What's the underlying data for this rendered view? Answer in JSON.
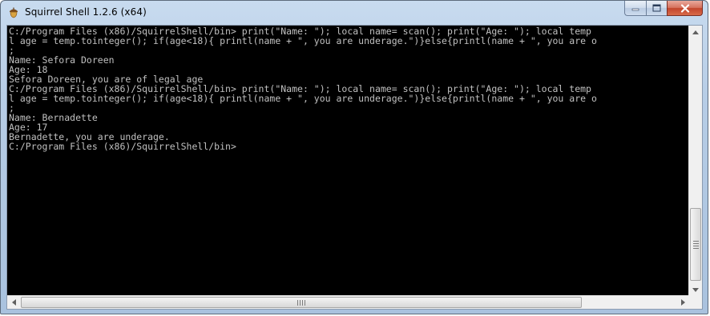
{
  "window": {
    "title": "Squirrel Shell 1.2.6 (x64)",
    "icon": "acorn-icon"
  },
  "caption_buttons": {
    "minimize_icon": "minimize-icon",
    "maximize_icon": "maximize-icon",
    "close_icon": "close-icon"
  },
  "console": {
    "lines": [
      "C:/Program Files (x86)/SquirrelShell/bin> print(\"Name: \"); local name= scan(); print(\"Age: \"); local temp",
      "l age = temp.tointeger(); if(age<18){ printl(name + \", you are underage.\")}else{printl(name + \", you are o",
      ";",
      "Name: Sefora Doreen",
      "Age: 18",
      "Sefora Doreen, you are of legal age",
      "C:/Program Files (x86)/SquirrelShell/bin> print(\"Name: \"); local name= scan(); print(\"Age: \"); local temp",
      "l age = temp.tointeger(); if(age<18){ printl(name + \", you are underage.\")}else{printl(name + \", you are o",
      ";",
      "Name: Bernadette",
      "Age: 17",
      "Bernadette, you are underage.",
      "C:/Program Files (x86)/SquirrelShell/bin>"
    ],
    "text_color": "#c0c0c0",
    "background": "#000000"
  },
  "scrollbars": {
    "vertical": {
      "position": 0.85
    },
    "horizontal": {
      "position": 0.0
    }
  }
}
